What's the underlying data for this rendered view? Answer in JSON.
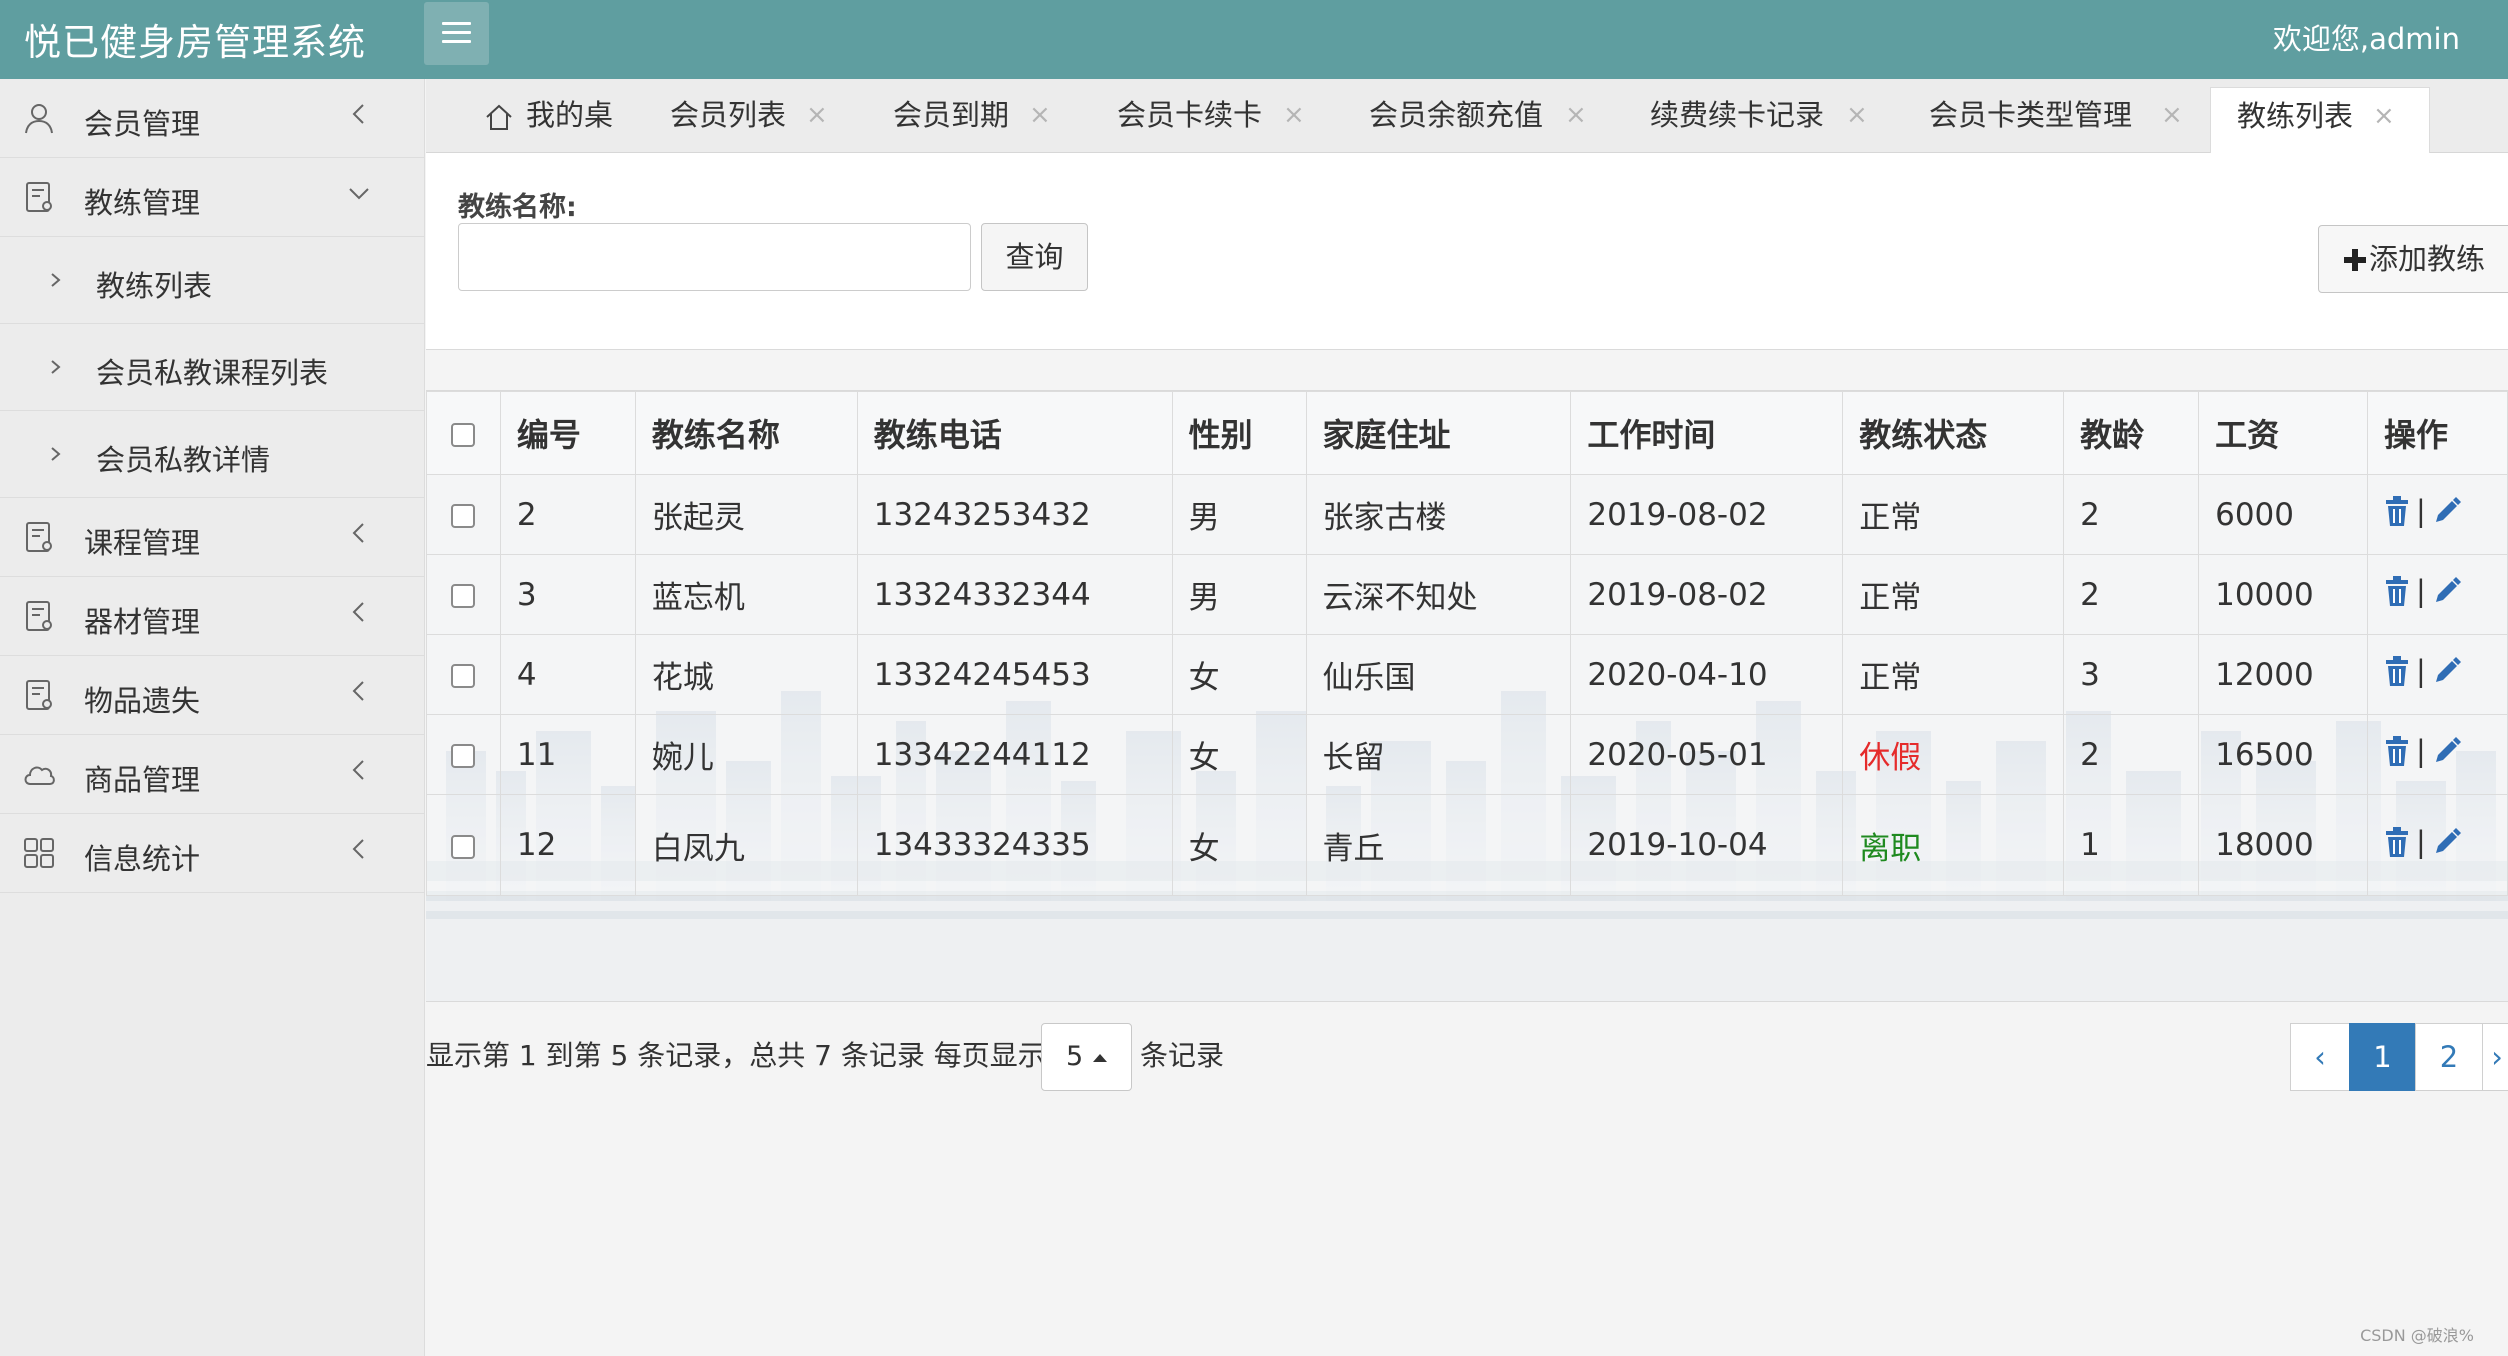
{
  "header": {
    "app_title": "悦已健身房管理系统",
    "welcome": "欢迎您,admin"
  },
  "sidebar": {
    "items": [
      {
        "label": "会员管理",
        "icon": "user-icon",
        "expanded": false
      },
      {
        "label": "教练管理",
        "icon": "document-icon",
        "expanded": true,
        "children": [
          {
            "label": "教练列表"
          },
          {
            "label": "会员私教课程列表"
          },
          {
            "label": "会员私教详情"
          }
        ]
      },
      {
        "label": "课程管理",
        "icon": "document-icon",
        "expanded": false
      },
      {
        "label": "器材管理",
        "icon": "document-icon",
        "expanded": false
      },
      {
        "label": "物品遗失",
        "icon": "document-icon",
        "expanded": false
      },
      {
        "label": "商品管理",
        "icon": "cloud-icon",
        "expanded": false
      },
      {
        "label": "信息统计",
        "icon": "grid-icon",
        "expanded": false
      }
    ]
  },
  "tabs": [
    {
      "label": "我的桌面",
      "icon": "home-icon",
      "closable": false
    },
    {
      "label": "会员列表",
      "closable": true
    },
    {
      "label": "会员到期",
      "closable": true
    },
    {
      "label": "会员卡续卡",
      "closable": true
    },
    {
      "label": "会员余额充值",
      "closable": true
    },
    {
      "label": "续费续卡记录",
      "closable": true
    },
    {
      "label": "会员卡类型管理",
      "closable": true
    },
    {
      "label": "教练列表",
      "closable": true,
      "active": true
    }
  ],
  "tab_close_glyph": "×",
  "search": {
    "label": "教练名称:",
    "value": "",
    "placeholder": "",
    "query_button": "查询",
    "add_button": "添加教练"
  },
  "table": {
    "columns": [
      "编号",
      "教练名称",
      "教练电话",
      "性别",
      "家庭住址",
      "工作时间",
      "教练状态",
      "教龄",
      "工资",
      "操作"
    ],
    "rows": [
      {
        "id": "2",
        "name": "张起灵",
        "phone": "13243253432",
        "gender": "男",
        "address": "张家古楼",
        "work_date": "2019-08-02",
        "status": "正常",
        "status_type": "normal",
        "years": "2",
        "salary": "6000"
      },
      {
        "id": "3",
        "name": "蓝忘机",
        "phone": "13324332344",
        "gender": "男",
        "address": "云深不知处",
        "work_date": "2019-08-02",
        "status": "正常",
        "status_type": "normal",
        "years": "2",
        "salary": "10000"
      },
      {
        "id": "4",
        "name": "花城",
        "phone": "13324245453",
        "gender": "女",
        "address": "仙乐国",
        "work_date": "2020-04-10",
        "status": "正常",
        "status_type": "normal",
        "years": "3",
        "salary": "12000"
      },
      {
        "id": "11",
        "name": "婉儿",
        "phone": "13342244112",
        "gender": "女",
        "address": "长留",
        "work_date": "2020-05-01",
        "status": "休假",
        "status_type": "leave",
        "years": "2",
        "salary": "16500"
      },
      {
        "id": "12",
        "name": "白凤九",
        "phone": "13433324335",
        "gender": "女",
        "address": "青丘",
        "work_date": "2019-10-04",
        "status": "离职",
        "status_type": "resigned",
        "years": "1",
        "salary": "18000"
      }
    ],
    "op_separator": "|"
  },
  "pager": {
    "summary": "显示第 1 到第 5 条记录，总共 7 条记录 每页显示",
    "page_size": "5",
    "suffix": "条记录",
    "prev": "‹",
    "pages": [
      "1",
      "2"
    ],
    "current_page": "1",
    "next": "›"
  },
  "colors": {
    "header_bg": "#5f9ea0",
    "accent_blue": "#337ab7",
    "status_leave": "#e52b2b",
    "status_resigned": "#1f8a1f"
  },
  "watermark": "CSDN @破浪%"
}
